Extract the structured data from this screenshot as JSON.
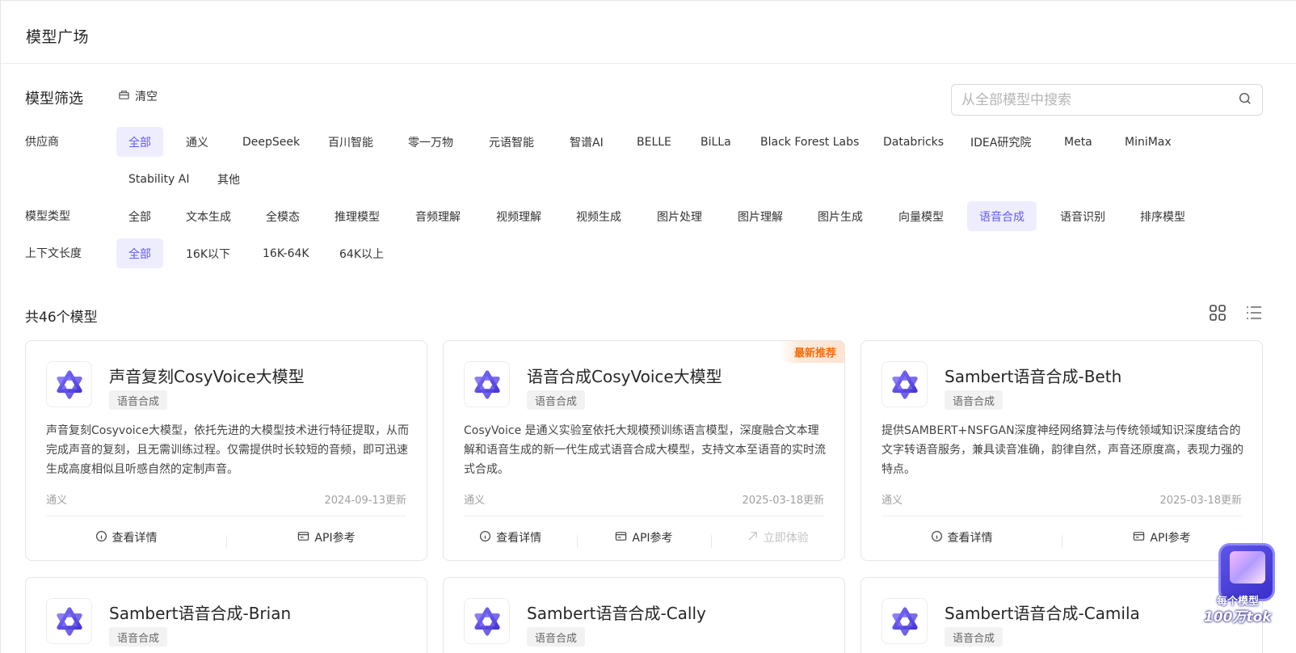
{
  "header": {
    "title": "模型广场"
  },
  "filters": {
    "title": "模型筛选",
    "clear_label": "清空",
    "search_placeholder": "从全部模型中搜索",
    "vendor": {
      "label": "供应商",
      "options": [
        "全部",
        "通义",
        "DeepSeek",
        "百川智能",
        "零一万物",
        "元语智能",
        "智谱AI",
        "BELLE",
        "BiLLa",
        "Black Forest Labs",
        "Databricks",
        "IDEA研究院",
        "Meta",
        "MiniMax",
        "Stability AI",
        "其他"
      ],
      "selected": "全部"
    },
    "model_type": {
      "label": "模型类型",
      "options": [
        "全部",
        "文本生成",
        "全模态",
        "推理模型",
        "音频理解",
        "视频理解",
        "视频生成",
        "图片处理",
        "图片理解",
        "图片生成",
        "向量模型",
        "语音合成",
        "语音识别",
        "排序模型"
      ],
      "selected": "语音合成"
    },
    "context_length": {
      "label": "上下文长度",
      "options": [
        "全部",
        "16K以下",
        "16K-64K",
        "64K以上"
      ],
      "selected": "全部"
    }
  },
  "results": {
    "count_text": "共46个模型"
  },
  "actions": {
    "detail": "查看详情",
    "api": "API参考",
    "try": "立即体验"
  },
  "cards": [
    {
      "title": "声音复刻CosyVoice大模型",
      "tag": "语音合成",
      "desc": "声音复刻Cosyvoice大模型，依托先进的大模型技术进行特征提取，从而完成声音的复刻，且无需训练过程。仅需提供时长较短的音频，即可迅速生成高度相似且听感自然的定制声音。",
      "vendor": "通义",
      "date": "2024-09-13更新"
    },
    {
      "title": "语音合成CosyVoice大模型",
      "tag": "语音合成",
      "badge": "最新推荐",
      "desc": "CosyVoice 是通义实验室依托大规模预训练语言模型，深度融合文本理解和语音生成的新一代生成式语音合成大模型，支持文本至语音的实时流式合成。",
      "vendor": "通义",
      "date": "2025-03-18更新"
    },
    {
      "title": "Sambert语音合成-Beth",
      "tag": "语音合成",
      "desc": "提供SAMBERT+NSFGAN深度神经网络算法与传统领域知识深度结合的文字转语音服务，兼具读音准确，韵律自然，声音还原度高，表现力强的特点。",
      "vendor": "通义",
      "date": "2025-03-18更新"
    },
    {
      "title": "Sambert语音合成-Brian",
      "tag": "语音合成"
    },
    {
      "title": "Sambert语音合成-Cally",
      "tag": "语音合成"
    },
    {
      "title": "Sambert语音合成-Camila",
      "tag": "语音合成"
    }
  ],
  "promo": {
    "line1": "每个模型",
    "line2": "100万tok"
  }
}
